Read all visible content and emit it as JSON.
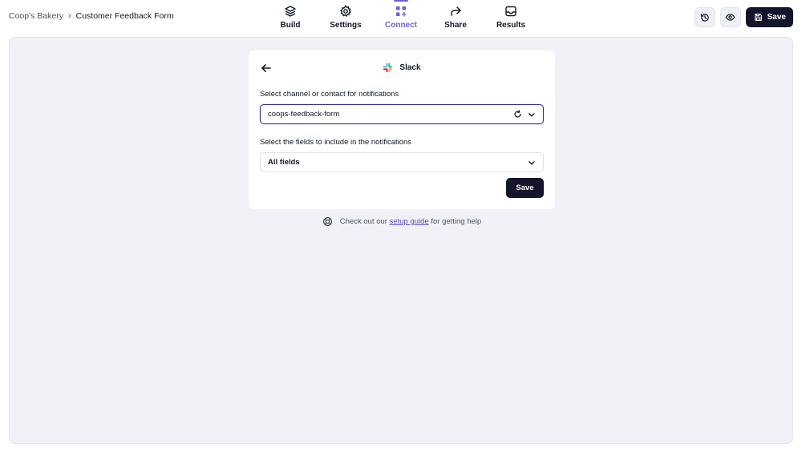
{
  "breadcrumb": {
    "parent": "Coop's Bakery",
    "separator": "›",
    "current": "Customer Feedback Form"
  },
  "nav": {
    "items": [
      {
        "label": "Build",
        "icon": "layers-icon"
      },
      {
        "label": "Settings",
        "icon": "gear-icon"
      },
      {
        "label": "Connect",
        "icon": "grid-plus-icon",
        "active": true
      },
      {
        "label": "Share",
        "icon": "share-arrow-icon"
      },
      {
        "label": "Results",
        "icon": "inbox-icon"
      }
    ]
  },
  "actions": {
    "history_icon": "history-icon",
    "preview_icon": "eye-icon",
    "save_label": "Save",
    "save_icon": "floppy-disk-icon"
  },
  "integration": {
    "title": "Slack",
    "logo": "slack-logo-icon",
    "channel_label": "Select channel or contact for notifications",
    "channel_value": "coops-feedback-form",
    "fields_label": "Select the fields to include in the notifications",
    "fields_value": "All fields",
    "save_label": "Save"
  },
  "help": {
    "prefix": "Check out our",
    "link": "setup guide",
    "suffix": "for getting help",
    "icon": "lifebuoy-icon"
  },
  "colors": {
    "accent": "#6d5fd0",
    "dark": "#14142b",
    "canvas": "#f1f2f7"
  }
}
